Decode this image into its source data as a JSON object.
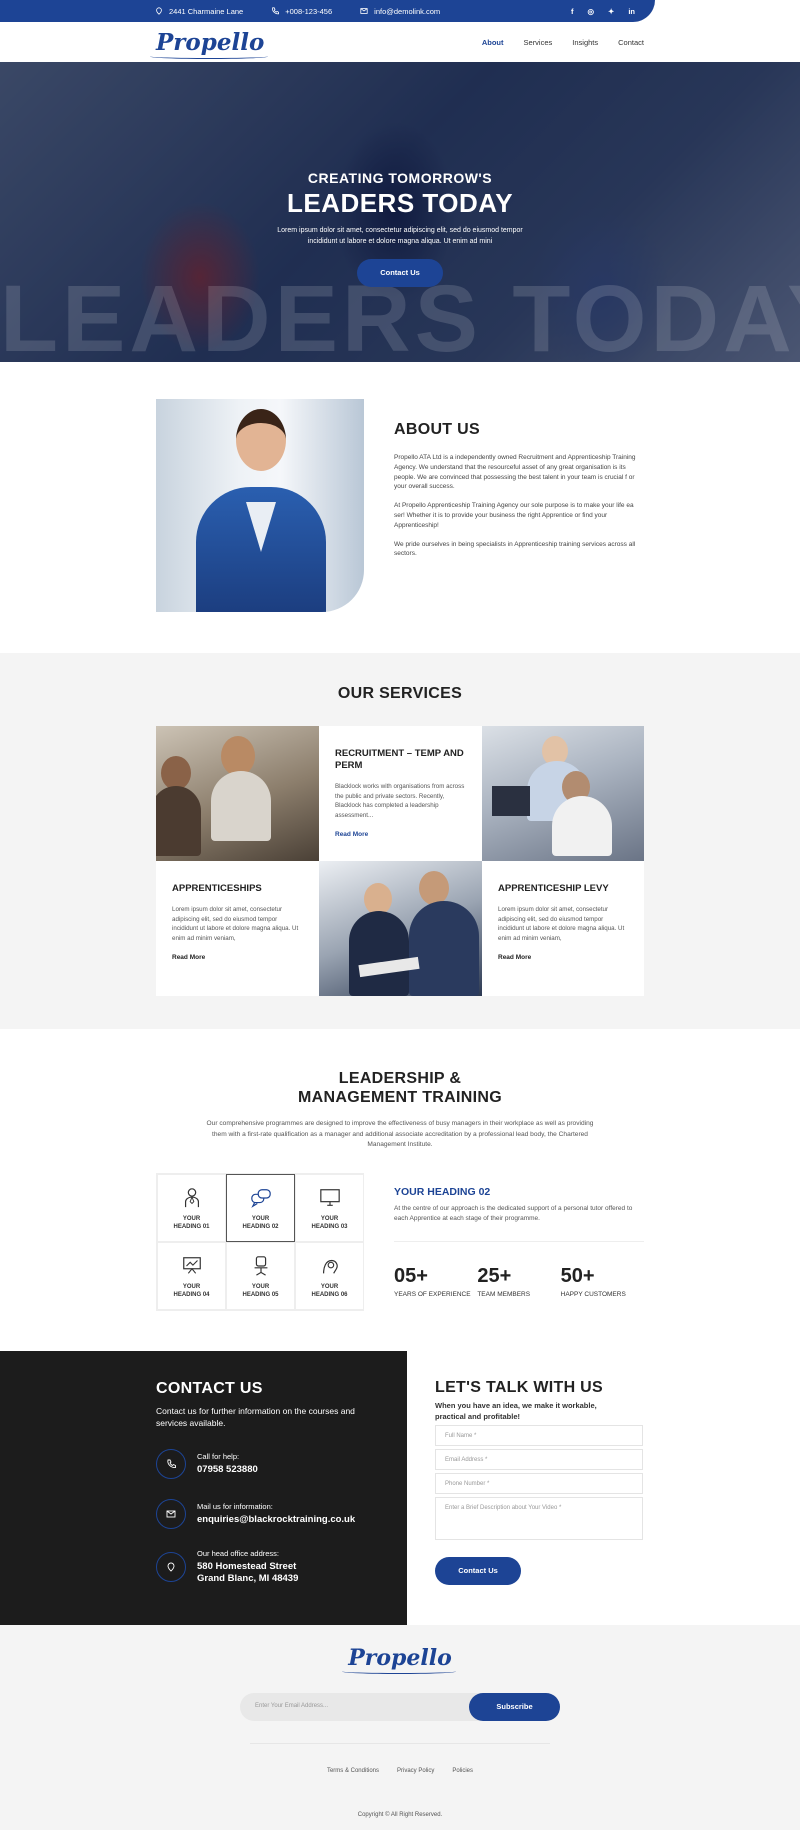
{
  "colors": {
    "brand": "#1d4495",
    "dark": "#1c1c1c",
    "light_bg": "#f4f4f4"
  },
  "topbar": {
    "address": "2441 Charmaine Lane",
    "phone": "+008-123-456",
    "email": "info@demolink.com",
    "social": [
      "f",
      "ig",
      "tw",
      "in"
    ]
  },
  "nav": {
    "logo": "Propello",
    "menu": [
      "About",
      "Services",
      "Insights",
      "Contact"
    ],
    "active": "About"
  },
  "hero": {
    "subtitle": "CREATING TOMORROW'S",
    "title": "LEADERS TODAY",
    "text": "Lorem ipsum dolor sit amet, consectetur adipiscing elit, sed do eiusmod tempor incididunt ut labore et dolore magna aliqua. Ut enim ad mini",
    "button": "Contact Us",
    "watermark": "LEADERS TODAY"
  },
  "about": {
    "title": "ABOUT US",
    "paragraphs": [
      "Propello ATA Ltd is a independently owned Recruitment and Apprenticeship Training Agency. We understand that the resourceful asset of any great organisation is its people. We are convinced that possessing the best talent in your team is crucial f or your overall success.",
      "At Propello Apprenticeship Training Agency our sole purpose is to make your life ea ser! Whether it is to provide your business the right Apprentice or find your Apprenticeship!",
      "We pride ourselves in being specialists in Apprenticeship training services across all sectors."
    ]
  },
  "services": {
    "title": "OUR SERVICES",
    "cards": [
      {
        "title": "RECRUITMENT – TEMP AND PERM",
        "text": "Blacklock works with organisations from across the public and private sectors. Recently, Blacklock has completed a leadership assessment...",
        "link": "Read More"
      },
      {
        "title": "APPRENTICESHIPS",
        "text": "Lorem ipsum dolor sit amet, consectetur adipiscing elit, sed do eiusmod tempor incididunt ut labore et dolore magna aliqua. Ut enim ad minim veniam,",
        "link": "Read More"
      },
      {
        "title": "APPRENTICESHIP LEVY",
        "text": "Lorem ipsum dolor sit amet, consectetur adipiscing elit, sed do eiusmod tempor incididunt ut labore et dolore magna aliqua. Ut enim ad minim veniam,",
        "link": "Read More"
      }
    ]
  },
  "leadership": {
    "title_line1": "LEADERSHIP &",
    "title_line2": "MANAGEMENT TRAINING",
    "description": "Our comprehensive programmes are designed to improve the effectiveness of busy managers in their workplace as well as providing them with a first-rate qualification as a manager and additional associate accreditation by a professional lead body, the Chartered Management Institute.",
    "headings": [
      {
        "line1": "YOUR",
        "line2": "HEADING 01",
        "icon": "person-icon"
      },
      {
        "line1": "YOUR",
        "line2": "HEADING 02",
        "icon": "chat-icon"
      },
      {
        "line1": "YOUR",
        "line2": "HEADING 03",
        "icon": "monitor-icon"
      },
      {
        "line1": "YOUR",
        "line2": "HEADING 04",
        "icon": "presentation-icon"
      },
      {
        "line1": "YOUR",
        "line2": "HEADING 05",
        "icon": "chair-icon"
      },
      {
        "line1": "YOUR",
        "line2": "HEADING 06",
        "icon": "idea-icon"
      }
    ],
    "selected_index": 1,
    "detail_title": "YOUR HEADING 02",
    "detail_text": "At the centre of our approach is the dedicated support of a personal tutor offered to each Apprentice at each stage of their programme.",
    "stats": [
      {
        "value": "05+",
        "label": "YEARS OF EXPERIENCE"
      },
      {
        "value": "25+",
        "label": "TEAM MEMBERS"
      },
      {
        "value": "50+",
        "label": "HAPPY CUSTOMERS"
      }
    ]
  },
  "contact": {
    "title": "CONTACT US",
    "subtitle": "Contact us for further information on the courses and services available.",
    "items": [
      {
        "label": "Call for help:",
        "value": "07958 523880",
        "icon": "phone-icon"
      },
      {
        "label": "Mail us for information:",
        "value": "enquiries@blackrocktraining.co.uk",
        "icon": "mail-icon"
      },
      {
        "label": "Our head office address:",
        "value": "580 Homestead Street",
        "value2": "Grand Blanc, MI 48439",
        "icon": "location-icon"
      }
    ],
    "form_title": "LET'S TALK WITH US",
    "form_subtitle": "When you have an idea, we make it workable, practical and profitable!",
    "fields": {
      "name": "Full Name *",
      "email": "Email Address *",
      "phone": "Phone Number *",
      "message": "Enter a Brief Description about Your Video *"
    },
    "button": "Contact Us"
  },
  "footer": {
    "logo": "Propello",
    "email_placeholder": "Enter Your Email Address...",
    "subscribe": "Subscribe",
    "links": [
      "Terms & Conditions",
      "Privacy Policy",
      "Policies"
    ],
    "copyright": "Copyright © All Right Reserved."
  }
}
